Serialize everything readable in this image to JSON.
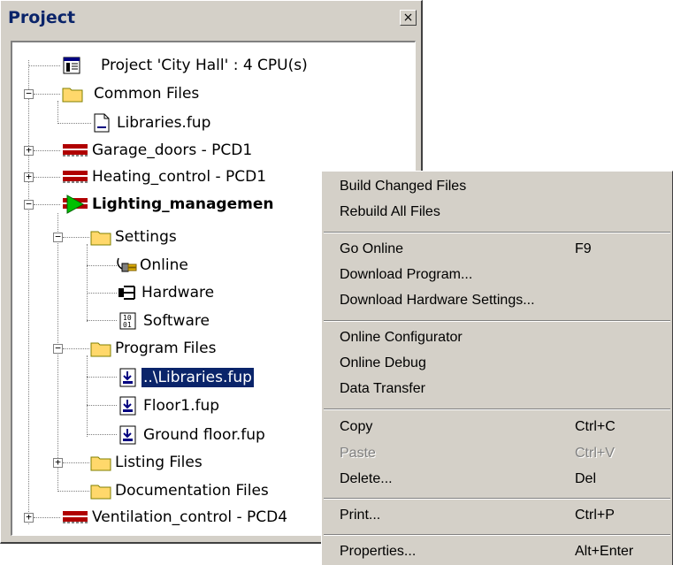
{
  "window": {
    "title": "Project",
    "close_glyph": "×"
  },
  "tree": {
    "project": "Project 'City Hall' : 4 CPU(s)",
    "common_files": "Common Files",
    "libraries_common": "Libraries.fup",
    "garage": "Garage_doors - PCD1",
    "heating": "Heating_control - PCD1",
    "lighting": "Lighting_managemen",
    "settings": "Settings",
    "online": "Online",
    "hardware": "Hardware",
    "software": "Software",
    "program_files": "Program Files",
    "libraries_ref": "..\\Libraries.fup",
    "floor1": "Floor1.fup",
    "ground_floor": "Ground floor.fup",
    "listing_files": "Listing Files",
    "documentation_files": "Documentation Files",
    "ventilation": "Ventilation_control - PCD4"
  },
  "menu": {
    "build_changed": "Build Changed Files",
    "rebuild_all": "Rebuild All Files",
    "go_online": "Go Online",
    "go_online_shortcut": "F9",
    "download_program": "Download Program...",
    "download_hw": "Download Hardware Settings...",
    "online_configurator": "Online Configurator",
    "online_debug": "Online Debug",
    "data_transfer": "Data Transfer",
    "copy": "Copy",
    "copy_shortcut": "Ctrl+C",
    "paste": "Paste",
    "paste_shortcut": "Ctrl+V",
    "delete": "Delete...",
    "delete_shortcut": "Del",
    "print": "Print...",
    "print_shortcut": "Ctrl+P",
    "properties": "Properties...",
    "properties_shortcut": "Alt+Enter"
  },
  "colors": {
    "selection": "#0a246a",
    "folder": "#ffd86b",
    "cpu_red": "#b00000",
    "active_green": "#00b000"
  },
  "icons": {
    "project": "project-icon",
    "folder": "folder-icon",
    "file": "file-icon",
    "cpu": "cpu-icon",
    "active_cpu": "active-cpu-icon",
    "online": "online-plug-icon",
    "hardware": "hardware-icon",
    "software": "software-icon",
    "fup_file": "fup-file-icon"
  }
}
